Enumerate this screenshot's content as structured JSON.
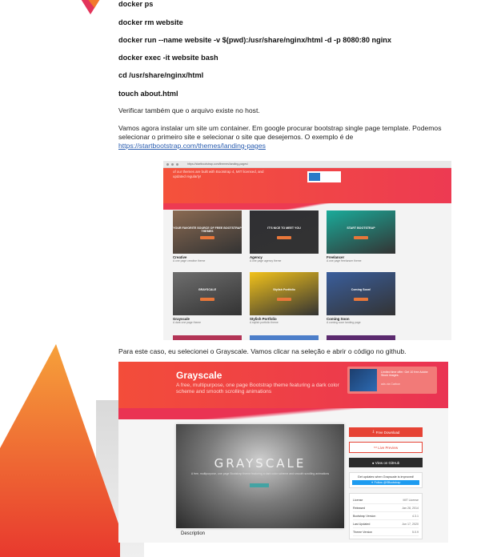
{
  "commands": [
    "docker ps",
    "docker rm website",
    "docker run --name website -v $(pwd):/usr/share/nginx/html -d -p 8080:80 nginx",
    "docker exec -it website bash",
    "cd /usr/share/nginx/html",
    "touch about.html"
  ],
  "paragraphs": {
    "verify": "Verificar também que o arquivo existe no host.",
    "install_text": "Vamos agora instalar um site um container. Em google procurar bootstrap single page template. Podemos selecionar o primeiro site e selecionar o site que desejemos. O exemplo é de ",
    "install_link": "https://startbootstrap.com/themes/landing-pages",
    "grayscale_choice": "Para este caso, eu selecionei o Grayscale. Vamos clicar na seleção e abrir o código no github."
  },
  "screenshot1": {
    "url": "https://startbootstrap.com/themes/landing-pages/",
    "hero_text": "of our themes are built with Bootstrap 4, MIT licensed, and updated regularly!",
    "templates": [
      {
        "title": "Creative",
        "subtitle": "A one page creative theme",
        "label": "YOUR FAVORITE SOURCE OF FREE BOOTSTRAP THEMES",
        "color": "#8a6a52"
      },
      {
        "title": "Agency",
        "subtitle": "A one page agency theme",
        "label": "IT'S NICE TO MEET YOU",
        "color": "#2f2f33"
      },
      {
        "title": "Freelancer",
        "subtitle": "A one page freelancer theme",
        "label": "START BOOTSTRAP",
        "color": "#1aab9a"
      },
      {
        "title": "Grayscale",
        "subtitle": "A dark one page theme",
        "label": "GRAYSCALE",
        "color": "#6e6e6e"
      },
      {
        "title": "Stylish Portfolio",
        "subtitle": "A stylish portfolio theme",
        "label": "Stylish Portfolio",
        "color": "#f2c21b"
      },
      {
        "title": "Coming Soon",
        "subtitle": "A coming soon landing page",
        "label": "Coming Soon!",
        "color": "#3a5e9c"
      }
    ]
  },
  "screenshot2": {
    "title": "Grayscale",
    "subtitle": "A free, multipurpose, one page Bootstrap theme featuring a dark color scheme and smooth scrolling animations",
    "ad_text": "Limited time offer: Get 10 free Adobe Stock images.",
    "ad_caption": "ads via Carbon",
    "hero_word": "GRAYSCALE",
    "buttons": {
      "download": "Free Download",
      "preview": "Live Preview",
      "github": "View on GitHub"
    },
    "updates_title": "Get updates when Grayscale is improved!",
    "follow": "Follow @SBootstrap",
    "info_rows": [
      {
        "label": "License",
        "value": "MIT License"
      },
      {
        "label": "Released",
        "value": "Jan 28, 2014"
      },
      {
        "label": "Bootstrap Version",
        "value": "4.3.1"
      },
      {
        "label": "Last Updated",
        "value": "Jun 17, 2020"
      },
      {
        "label": "Theme Version",
        "value": "5.0.9"
      }
    ],
    "description_heading": "Description"
  }
}
